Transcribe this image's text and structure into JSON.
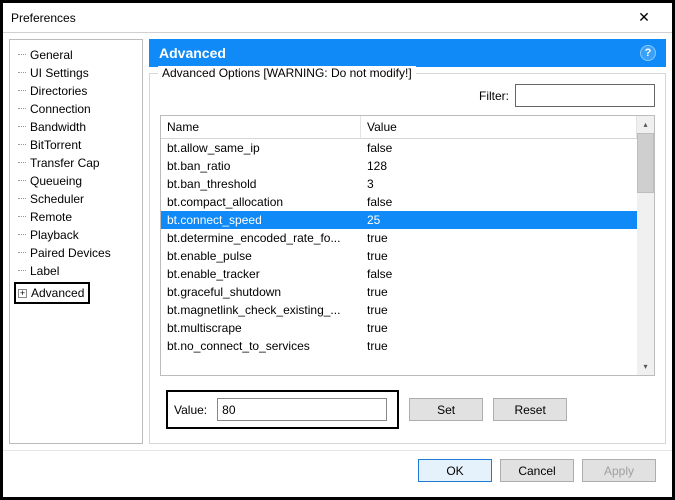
{
  "window": {
    "title": "Preferences"
  },
  "sidebar": {
    "items": [
      "General",
      "UI Settings",
      "Directories",
      "Connection",
      "Bandwidth",
      "BitTorrent",
      "Transfer Cap",
      "Queueing",
      "Scheduler",
      "Remote",
      "Playback",
      "Paired Devices",
      "Label"
    ],
    "advanced": "Advanced"
  },
  "banner": {
    "title": "Advanced"
  },
  "group": {
    "legend": "Advanced Options [WARNING: Do not modify!]",
    "filter_label": "Filter:",
    "filter_value": ""
  },
  "columns": {
    "name": "Name",
    "value": "Value"
  },
  "rows": [
    {
      "name": "bt.allow_same_ip",
      "value": "false",
      "selected": false
    },
    {
      "name": "bt.ban_ratio",
      "value": "128",
      "selected": false
    },
    {
      "name": "bt.ban_threshold",
      "value": "3",
      "selected": false
    },
    {
      "name": "bt.compact_allocation",
      "value": "false",
      "selected": false
    },
    {
      "name": "bt.connect_speed",
      "value": "25",
      "selected": true
    },
    {
      "name": "bt.determine_encoded_rate_fo...",
      "value": "true",
      "selected": false
    },
    {
      "name": "bt.enable_pulse",
      "value": "true",
      "selected": false
    },
    {
      "name": "bt.enable_tracker",
      "value": "false",
      "selected": false
    },
    {
      "name": "bt.graceful_shutdown",
      "value": "true",
      "selected": false
    },
    {
      "name": "bt.magnetlink_check_existing_...",
      "value": "true",
      "selected": false
    },
    {
      "name": "bt.multiscrape",
      "value": "true",
      "selected": false
    },
    {
      "name": "bt.no_connect_to_services",
      "value": "true",
      "selected": false
    }
  ],
  "value_edit": {
    "label": "Value:",
    "value": "80",
    "set": "Set",
    "reset": "Reset"
  },
  "footer": {
    "ok": "OK",
    "cancel": "Cancel",
    "apply": "Apply"
  }
}
